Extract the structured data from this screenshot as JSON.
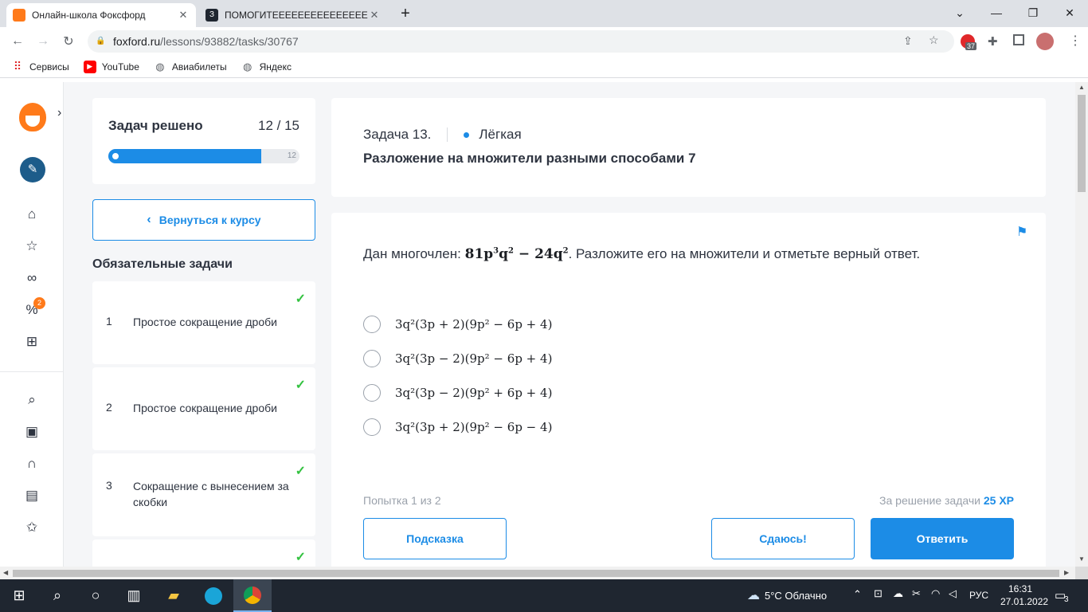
{
  "browser": {
    "tabs": [
      {
        "title": "Онлайн-школа Фоксфорд",
        "active": true
      },
      {
        "title": "ПОМОГИТЕЕЕЕЕЕЕЕЕЕЕЕЕЕЕЕЕЕЕЕ",
        "active": false
      }
    ],
    "new_tab": "+",
    "url_host": "foxford.ru",
    "url_path": "/lessons/93882/tasks/30767",
    "extension_badge": "37",
    "bookmarks": [
      "Сервисы",
      "YouTube",
      "Авиабилеты",
      "Яндекс"
    ]
  },
  "sidebar": {
    "badge_count": "2",
    "progress": {
      "title": "Задач решено",
      "count": "12 / 15",
      "marker": "12",
      "fraction": 0.8
    },
    "back_button": "Вернуться к курсу",
    "section_title": "Обязательные задачи",
    "tasks": [
      {
        "num": "1",
        "name": "Простое сокращение дроби",
        "solved": true
      },
      {
        "num": "2",
        "name": "Простое сокращение дроби",
        "solved": true
      },
      {
        "num": "3",
        "name": "Сокращение с вынесением за скобки",
        "solved": true
      }
    ]
  },
  "task": {
    "number": "Задача 13.",
    "difficulty": "Лёгкая",
    "title": "Разложение на множители разными способами 7",
    "question_prefix": "Дан многочлен:",
    "question_suffix": ". Разложите его на множители и отметьте верный ответ.",
    "options": [
      "3q²(3p + 2)(9p² − 6p + 4)",
      "3q²(3p − 2)(9p² − 6p + 4)",
      "3q²(3p − 2)(9p² + 6p + 4)",
      "3q²(3p + 2)(9p² − 6p − 4)"
    ],
    "attempt": "Попытка 1 из 2",
    "reward_label": "За решение задачи",
    "reward_xp": "25 XP",
    "hint_button": "Подсказка",
    "giveup_button": "Сдаюсь!",
    "answer_button": "Ответить"
  },
  "taskbar": {
    "weather": "5°C Облачно",
    "lang": "РУС",
    "time": "16:31",
    "date": "27.01.2022",
    "notifications": "3"
  },
  "colors": {
    "accent": "#1c8ce6",
    "success": "#34c241",
    "taskbar": "#1f2630"
  }
}
